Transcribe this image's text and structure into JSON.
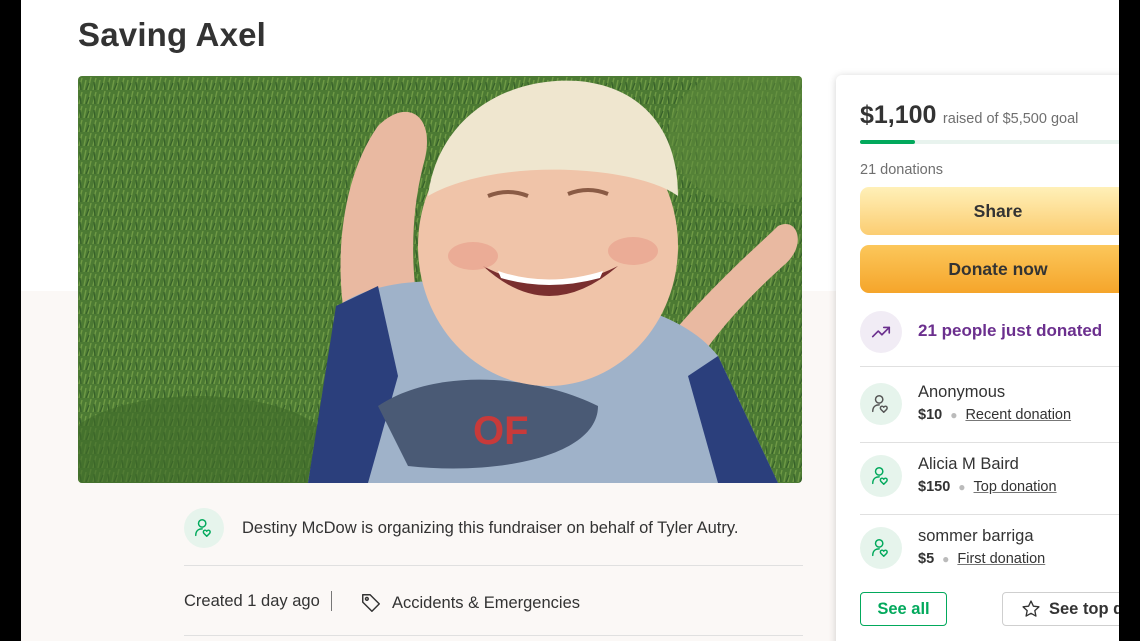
{
  "campaign": {
    "title": "Saving Axel",
    "organizer_text": "Destiny McDow is organizing this fundraiser on behalf of Tyler Autry.",
    "created": "Created 1 day ago",
    "category": "Accidents & Emergencies"
  },
  "donation_card": {
    "raised_amount": "$1,100",
    "raised_goal": "raised of $5,500 goal",
    "progress_fraction": 0.2,
    "donations_count": "21 donations",
    "share_label": "Share",
    "donate_label": "Donate now",
    "recent_activity": "21 people just donated",
    "donors": [
      {
        "name": "Anonymous",
        "amount": "$10",
        "tag": "Recent donation"
      },
      {
        "name": "Alicia M Baird",
        "amount": "$150",
        "tag": "Top donation"
      },
      {
        "name": "sommer barriga",
        "amount": "$5",
        "tag": "First donation"
      }
    ],
    "see_all_label": "See all",
    "see_top_label": "See top d"
  },
  "icons": {
    "organizer": "heart-hand-icon",
    "category": "tag-icon",
    "trending": "trending-up-icon",
    "donor": "heart-hand-icon",
    "see_top": "star-icon"
  },
  "colors": {
    "brand_green": "#02a95c",
    "purple_accent": "#6b2f8e",
    "donate_orange": "#f5a52b",
    "share_yellow": "#fbcd72"
  }
}
